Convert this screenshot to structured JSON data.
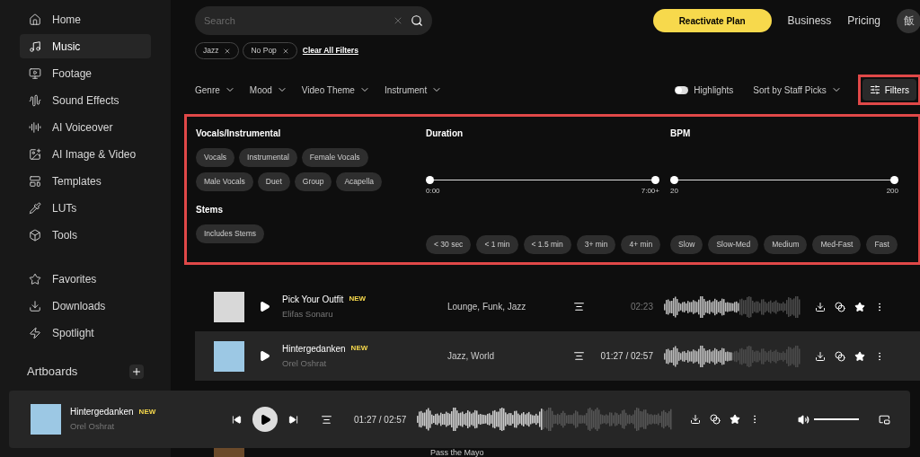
{
  "sidebar": {
    "items": [
      {
        "label": "Home",
        "selected": false
      },
      {
        "label": "Music",
        "selected": true
      },
      {
        "label": "Footage",
        "selected": false
      },
      {
        "label": "Sound Effects",
        "selected": false
      },
      {
        "label": "AI Voiceover",
        "selected": false
      },
      {
        "label": "AI Image & Video",
        "selected": false
      },
      {
        "label": "Templates",
        "selected": false
      },
      {
        "label": "LUTs",
        "selected": false
      },
      {
        "label": "Tools",
        "selected": false
      }
    ],
    "secondary": [
      {
        "label": "Favorites",
        "selected": false
      },
      {
        "label": "Downloads",
        "selected": false
      },
      {
        "label": "Spotlight",
        "selected": false
      }
    ],
    "artboards": {
      "label": "Artboards"
    }
  },
  "search": {
    "placeholder": "Search"
  },
  "header": {
    "cta": "Reactivate Plan",
    "links": [
      "Business",
      "Pricing"
    ],
    "avatar": "飯"
  },
  "active_filters": {
    "chips": [
      "Jazz",
      "No Pop"
    ],
    "clear": "Clear All Filters"
  },
  "toolbar": {
    "dropdowns": [
      "Genre",
      "Mood",
      "Video Theme",
      "Instrument"
    ],
    "highlights": {
      "label": "Highlights",
      "on": false
    },
    "sort": "Sort by Staff Picks",
    "filters_button": "Filters"
  },
  "filter_panel": {
    "sections": [
      {
        "kind": "chips",
        "title": "Vocals/Instrumental",
        "options": [
          {
            "label": "Vocals",
            "selected": false
          },
          {
            "label": "Instrumental",
            "selected": false
          },
          {
            "label": "Female Vocals",
            "selected": false
          },
          {
            "label": "Male Vocals",
            "selected": false
          },
          {
            "label": "Duet",
            "selected": false
          },
          {
            "label": "Group",
            "selected": false
          },
          {
            "label": "Acapella",
            "selected": false
          }
        ]
      },
      {
        "kind": "chips",
        "title": "Stems",
        "options": [
          {
            "label": "Includes Stems",
            "selected": false
          }
        ]
      },
      {
        "kind": "range",
        "title": "Duration",
        "level": 1,
        "min": "0:00",
        "max": "7:00+",
        "options": [
          {
            "label": "< 30 sec",
            "selected": false
          },
          {
            "label": "< 1 min",
            "selected": false
          },
          {
            "label": "< 1.5 min",
            "selected": false
          },
          {
            "label": "3+ min",
            "selected": false
          },
          {
            "label": "4+ min",
            "selected": false
          }
        ]
      },
      {
        "kind": "range",
        "title": "BPM",
        "level": 1,
        "min": "20",
        "max": "200",
        "options": [
          {
            "label": "Slow",
            "selected": false
          },
          {
            "label": "Slow-Med",
            "selected": false
          },
          {
            "label": "Medium",
            "selected": false
          },
          {
            "label": "Med-Fast",
            "selected": false
          },
          {
            "label": "Fast",
            "selected": false
          }
        ]
      }
    ]
  },
  "tracks": [
    {
      "title": "Pick Your Outfit",
      "badge": "NEW",
      "artist": "Elifas Sonaru",
      "genres": "Lounge, Funk, Jazz",
      "time": "02:23",
      "level": 0.55,
      "selected": false
    },
    {
      "title": "Hintergedanken",
      "badge": "NEW",
      "artist": "Orel Oshrat",
      "genres": "Jazz, World",
      "time": "01:27 / 02:57",
      "level": 0.49,
      "selected": true
    }
  ],
  "peek_track": {
    "title": "Pass the Mayo"
  },
  "player": {
    "title": "Hintergedanken",
    "badge": "NEW",
    "artist": "Orel Oshrat",
    "time": "01:27 / 02:57",
    "level": 0.49,
    "volume": {
      "level": 1
    }
  }
}
